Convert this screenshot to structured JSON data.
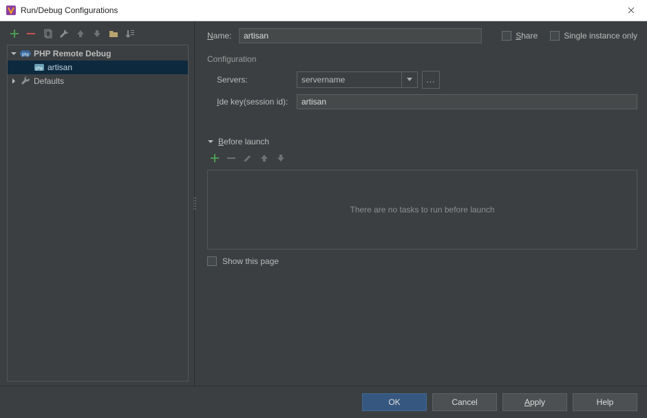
{
  "title": "Run/Debug Configurations",
  "toolbar": {
    "items": [
      "add",
      "remove",
      "copy",
      "settings",
      "up",
      "down",
      "folder",
      "sort"
    ]
  },
  "tree": {
    "php_remote_debug": {
      "label": "PHP Remote Debug"
    },
    "artisan": {
      "label": "artisan"
    },
    "defaults": {
      "label": "Defaults"
    }
  },
  "right": {
    "name_label": "Name:",
    "name_value": "artisan",
    "share_label": "Share",
    "single_instance_label": "Single instance only",
    "configuration_label": "Configuration",
    "servers_label": "Servers:",
    "server_selected": "servername",
    "ide_key_label_pre": "I",
    "ide_key_label_post": "de key(session id):",
    "ide_key_value": "artisan",
    "before_launch_label_pre": "B",
    "before_launch_label_post": "efore launch",
    "no_tasks": "There are no tasks to run before launch",
    "show_this_page": "Show this page"
  },
  "footer": {
    "ok": "OK",
    "cancel": "Cancel",
    "apply": "Apply",
    "help": "Help"
  }
}
